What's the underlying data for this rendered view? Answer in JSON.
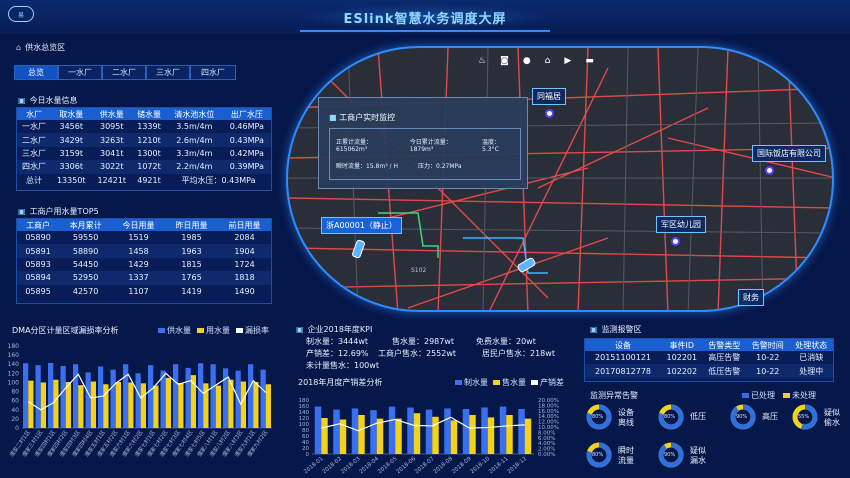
{
  "header": {
    "title": "ESlink智慧水务调度大屏",
    "logo_text": "易"
  },
  "supply": {
    "title": "供水总览区",
    "tabs": [
      "总览",
      "一水厂",
      "二水厂",
      "三水厂",
      "四水厂"
    ]
  },
  "today": {
    "title": "今日水量信息",
    "headers": [
      "水厂",
      "取水量",
      "供水量",
      "储水量",
      "清水池水位",
      "出厂水压"
    ],
    "rows": [
      [
        "一水厂",
        "3456t",
        "3095t",
        "1339t",
        "3.5m/4m",
        "0.46MPa"
      ],
      [
        "二水厂",
        "3429t",
        "3263t",
        "1210t",
        "2.6m/4m",
        "0.43MPa"
      ],
      [
        "三水厂",
        "3159t",
        "3041t",
        "1300t",
        "3.3m/4m",
        "0.42MPa"
      ],
      [
        "四水厂",
        "3306t",
        "3022t",
        "1072t",
        "2.2m/4m",
        "0.39MPa"
      ]
    ],
    "total": [
      "总计",
      "13350t",
      "12421t",
      "4921t",
      "平均水压：0.43MPa"
    ]
  },
  "top5": {
    "title": "工商户用水量TOP5",
    "headers": [
      "工商户",
      "本月累计",
      "今日用量",
      "昨日用量",
      "前日用量"
    ],
    "rows": [
      [
        "05890",
        "59550",
        "1519",
        "1985",
        "2084"
      ],
      [
        "05891",
        "58890",
        "1458",
        "1963",
        "1904"
      ],
      [
        "05893",
        "54450",
        "1429",
        "1815",
        "1724"
      ],
      [
        "05894",
        "52950",
        "1337",
        "1765",
        "1818"
      ],
      [
        "05895",
        "42570",
        "1107",
        "1419",
        "1490"
      ]
    ]
  },
  "dma": {
    "title": "DMA分区计量区域漏损率分析",
    "legend": [
      "供水量",
      "用水量",
      "漏损率"
    ],
    "colors": {
      "supply": "#3a6ff0",
      "use": "#f2d31a",
      "loss": "#ffffff"
    }
  },
  "chart_data": [
    {
      "type": "bar",
      "title": "DMA分区计量区域漏损率分析",
      "ylim": [
        0,
        180
      ],
      "yticks": [
        "180",
        "160",
        "140",
        "120",
        "100",
        "80",
        "60",
        "40",
        "20",
        "0"
      ],
      "categories": [
        "濮家二村1区",
        "濮家三村1区",
        "濮家四村1区",
        "濮家四村2区",
        "濮家四村3区",
        "濮家四村4区",
        "濮家五村1区",
        "濮家五村2区",
        "濮家六村1区",
        "濮家六村2区",
        "濮家七村1区",
        "濮家七村2区",
        "濮家七村3区",
        "濮家七村4区",
        "濮家七村5区",
        "濮家八村1区",
        "濮家八村2区",
        "濮家八村3区",
        "濮家九村1区",
        "濮家九村2区"
      ],
      "series": [
        {
          "name": "供水量",
          "values": [
            142,
            138,
            143,
            136,
            140,
            122,
            135,
            128,
            140,
            120,
            138,
            126,
            140,
            132,
            142,
            140,
            131,
            126,
            140,
            128
          ]
        },
        {
          "name": "用水量",
          "values": [
            104,
            100,
            106,
            101,
            94,
            102,
            96,
            101,
            100,
            98,
            93,
            110,
            99,
            116,
            98,
            93,
            106,
            102,
            101,
            96
          ]
        },
        {
          "name": "漏损率",
          "values": [
            58,
            40,
            55,
            88,
            118,
            66,
            70,
            98,
            118,
            66,
            88,
            120,
            96,
            104,
            76,
            94,
            112,
            52,
            104,
            78
          ]
        }
      ]
    },
    {
      "type": "bar",
      "title": "2018年月度产销差分析",
      "ylim": [
        0,
        180
      ],
      "yticks": [
        "180",
        "160",
        "140",
        "120",
        "100",
        "80",
        "60",
        "40",
        "20",
        "0"
      ],
      "y2ticks": [
        "20.00%",
        "18.00%",
        "16.00%",
        "14.00%",
        "12.00%",
        "10.00%",
        "8.00%",
        "6.00%",
        "4.00%",
        "2.00%",
        "0.00%"
      ],
      "categories": [
        "2018-01",
        "2018-02",
        "2018-03",
        "2018-04",
        "2018-05",
        "2018-06",
        "2018-07",
        "2018-08",
        "2018-09",
        "2018-10",
        "2018-11",
        "2018-12"
      ],
      "series": [
        {
          "name": "制水量",
          "values": [
            158,
            148,
            152,
            146,
            158,
            155,
            148,
            152,
            150,
            155,
            158,
            150
          ]
        },
        {
          "name": "售水量",
          "values": [
            120,
            115,
            130,
            118,
            118,
            136,
            124,
            112,
            130,
            122,
            130,
            118
          ]
        },
        {
          "name": "产销差",
          "values": [
            9.6,
            11.2,
            8.6,
            11.4,
            12.8,
            10.6,
            10.4,
            13.6,
            9.6,
            9.8,
            10.4,
            10.8
          ]
        }
      ]
    }
  ],
  "kpi": {
    "title": "企业2018年度KPI",
    "items": [
      [
        "制水量：",
        "3444wt"
      ],
      [
        "售水量：",
        "2987wt"
      ],
      [
        "免费水量：",
        "20wt"
      ],
      [
        "产销差：",
        "12.69%"
      ],
      [
        "工商户售水：",
        "2552wt"
      ],
      [
        "居民户售水：",
        "218wt"
      ],
      [
        "未计量售水：",
        "100wt"
      ]
    ]
  },
  "monthly": {
    "title": "2018年月度产销差分析",
    "legend": [
      "制水量",
      "售水量",
      "产销差"
    ]
  },
  "map": {
    "toolbar_icons": [
      "fire-icon",
      "camera-icon",
      "location-pin-icon",
      "home-icon",
      "video-icon",
      "car-icon"
    ],
    "labels": {
      "tongfu": "同福居",
      "hotel": "国际饭店有限公司",
      "kindergarten": "军区幼儿园",
      "finance": "财务",
      "vehicle": "浙A00001（静止）",
      "road": "S102"
    },
    "popup": {
      "title": "工商户实时监控",
      "rows": [
        [
          [
            "正累计流量：",
            "615062m³"
          ],
          [
            "今日累计流量：",
            "1879m³"
          ],
          [
            "温度：",
            "5.3°C"
          ]
        ],
        [
          [
            "瞬时流量：",
            "15.8m³ / H"
          ],
          [
            "压力：",
            "0.27MPa"
          ]
        ]
      ]
    }
  },
  "alarm": {
    "title": "监测报警区",
    "headers": [
      "设备",
      "事件ID",
      "告警类型",
      "告警时间",
      "处理状态"
    ],
    "rows": [
      [
        "20151100121",
        "102201",
        "高压告警",
        "10-22",
        "已消缺"
      ],
      [
        "20170812778",
        "102202",
        "低压告警",
        "10-22",
        "处理中"
      ]
    ]
  },
  "anomaly": {
    "title": "监测异常告警",
    "legend": [
      "已处理",
      "未处理"
    ],
    "items": [
      {
        "pct": "80%",
        "label": [
          "设备",
          "离线"
        ],
        "done": 0.8
      },
      {
        "pct": "80%",
        "label": [
          "低压"
        ],
        "done": 0.8
      },
      {
        "pct": "90%",
        "label": [
          "高压"
        ],
        "done": 0.9
      },
      {
        "pct": "55%",
        "label": [
          "疑似",
          "偷水"
        ],
        "done": 0.55
      },
      {
        "pct": "80%",
        "label": [
          "瞬时",
          "流量"
        ],
        "done": 0.8
      },
      {
        "pct": "90%",
        "label": [
          "疑似",
          "漏水"
        ],
        "done": 0.9
      }
    ]
  }
}
